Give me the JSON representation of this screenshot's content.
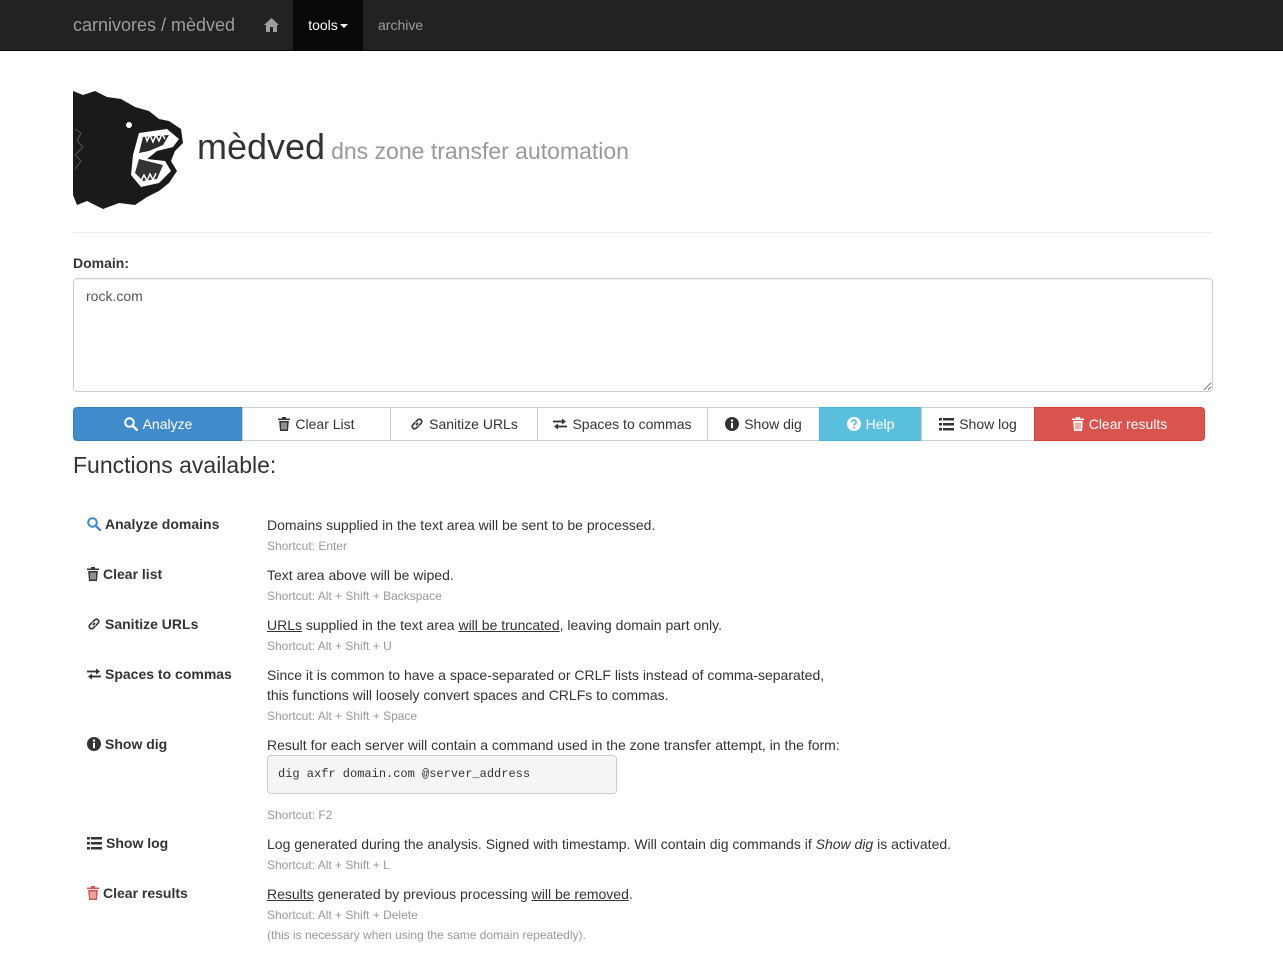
{
  "navbar": {
    "brand": "carnivores / mèdved",
    "tools_label": "tools",
    "archive_label": "archive"
  },
  "header": {
    "title": "mèdved",
    "subtitle": "dns zone transfer automation"
  },
  "domain": {
    "label": "Domain:",
    "value": "rock.com"
  },
  "toolbar": {
    "analyze": "Analyze",
    "clear_list": "Clear List",
    "sanitize_urls": "Sanitize URLs",
    "spaces_to_commas": "Spaces to commas",
    "show_dig": "Show dig",
    "help": "Help",
    "show_log": "Show log",
    "clear_results": "Clear results"
  },
  "functions": {
    "heading": "Functions available:",
    "analyze": {
      "name": "Analyze domains",
      "desc": "Domains supplied in the text area will be sent to be processed.",
      "shortcut": "Shortcut: Enter"
    },
    "clear_list": {
      "name": "Clear list",
      "desc": "Text area above will be wiped.",
      "shortcut": "Shortcut: Alt + Shift + Backspace"
    },
    "sanitize": {
      "name": "Sanitize URLs",
      "desc_p1": "URLs",
      "desc_p2": " supplied in the text area ",
      "desc_p3": "will be truncated",
      "desc_p4": ", leaving domain part only.",
      "shortcut": "Shortcut: Alt + Shift + U"
    },
    "spaces": {
      "name": "Spaces to commas",
      "desc_line1": "Since it is common to have a space-separated or CRLF lists instead of comma-separated,",
      "desc_line2": "this functions will loosely convert spaces and CRLFs to commas.",
      "shortcut": "Shortcut: Alt + Shift + Space"
    },
    "show_dig": {
      "name": "Show dig",
      "desc": "Result for each server will contain a command used in the zone transfer attempt, in the form:",
      "code": "dig axfr domain.com @server_address",
      "shortcut": "Shortcut: F2"
    },
    "show_log": {
      "name": "Show log",
      "desc_p1": "Log generated during the analysis. Signed with timestamp. Will contain dig commands if ",
      "desc_em": "Show dig",
      "desc_p2": " is activated.",
      "shortcut": "Shortcut: Alt + Shift + L"
    },
    "clear_results": {
      "name": "Clear results",
      "desc_p1": "Results",
      "desc_p2": " generated by previous processing ",
      "desc_p3": "will be removed",
      "desc_p4": ".",
      "shortcut": "Shortcut: Alt + Shift + Delete",
      "note": "(this is necessary when using the same domain repeatedly)."
    }
  },
  "colors": {
    "navbar_bg": "#222222",
    "primary": "#428bca",
    "info": "#5bc0de",
    "danger": "#d9534f"
  },
  "icons": [
    "home-icon",
    "search-icon",
    "trash-icon",
    "link-icon",
    "transfer-icon",
    "info-sign-icon",
    "question-sign-icon",
    "list-icon",
    "bear-logo"
  ]
}
